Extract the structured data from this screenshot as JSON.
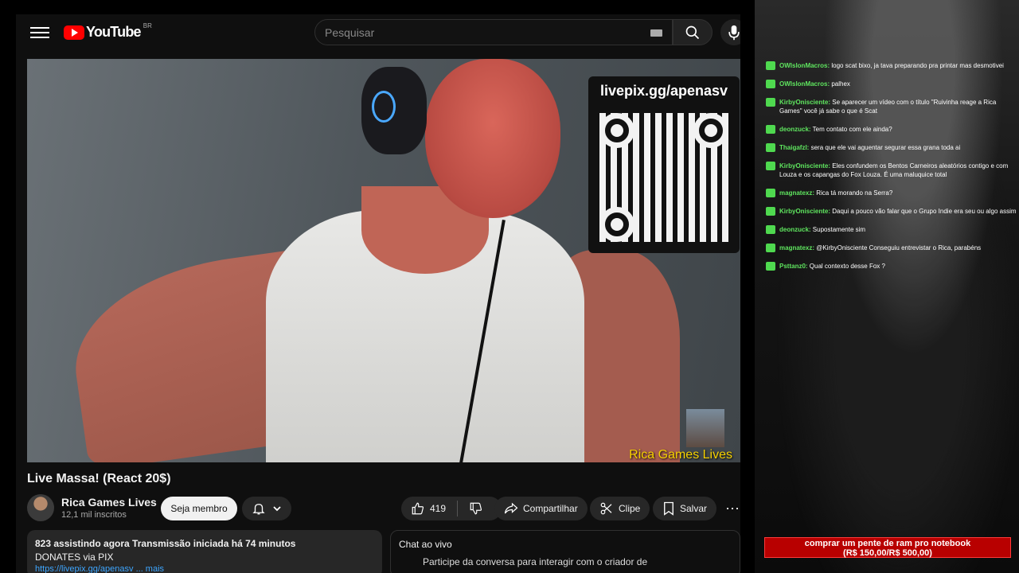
{
  "youtube": {
    "header": {
      "logo_text": "YouTube",
      "country_code": "BR",
      "search_placeholder": "Pesquisar"
    },
    "video": {
      "qr_caption": "livepix.gg/apenasv",
      "watermark": "Rica Games Lives"
    },
    "title": "Live Massa! (React 20$)",
    "channel": {
      "name": "Rica Games Lives",
      "subscribers": "12,1 mil inscritos",
      "member_button": "Seja membro"
    },
    "actions": {
      "likes": "419",
      "share": "Compartilhar",
      "clip": "Clipe",
      "save": "Salvar",
      "more": "⋯"
    },
    "description": {
      "stats": "823 assistindo agora  Transmissão iniciada há 74 minutos",
      "line2": "DONATES via PIX",
      "link": "https://livepix.gg/apenasv ... mais"
    },
    "chat": {
      "title": "Chat ao vivo",
      "prompt": "Participe da conversa para interagir com o criador de"
    }
  },
  "stream_chat": {
    "messages": [
      {
        "user": "OWlslonMacros:",
        "text": "logo scat bixo, ja tava preparando pra printar mas desmotivei"
      },
      {
        "user": "OWlslonMacros:",
        "text": "palhex"
      },
      {
        "user": "KirbyOnisciente:",
        "text": "Se aparecer um vídeo com o título \"Ruivinha reage a Rica Games\" você já sabe o que é Scat"
      },
      {
        "user": "deonzuck:",
        "text": "Tem contato com ele ainda?"
      },
      {
        "user": "Thaigafzl:",
        "text": "sera que ele vai aguentar segurar essa grana toda ai"
      },
      {
        "user": "KirbyOnisciente:",
        "text": "Eles confundem os Bentos Carneiros aleatórios contigo e com Louza e os capangas do Fox Louza. É uma maluquice total"
      },
      {
        "user": "magnatexz:",
        "text": "Rica tá morando na Serra?"
      },
      {
        "user": "KirbyOnisciente:",
        "text": "Daqui a pouco vão falar que o Grupo Indie era seu ou algo assim"
      },
      {
        "user": "deonzuck:",
        "text": "Supostamente sim"
      },
      {
        "user": "magnatexz:",
        "text": "@KirbyOnisciente Conseguiu entrevistar o Rica, parabéns"
      },
      {
        "user": "Psttanz0:",
        "text": "Qual contexto desse Fox ?"
      }
    ],
    "donation_goal": {
      "line1": "comprar um pente de ram pro notebook",
      "line2": "(R$ 150,00/R$ 500,00)",
      "progress": 0.3
    }
  }
}
